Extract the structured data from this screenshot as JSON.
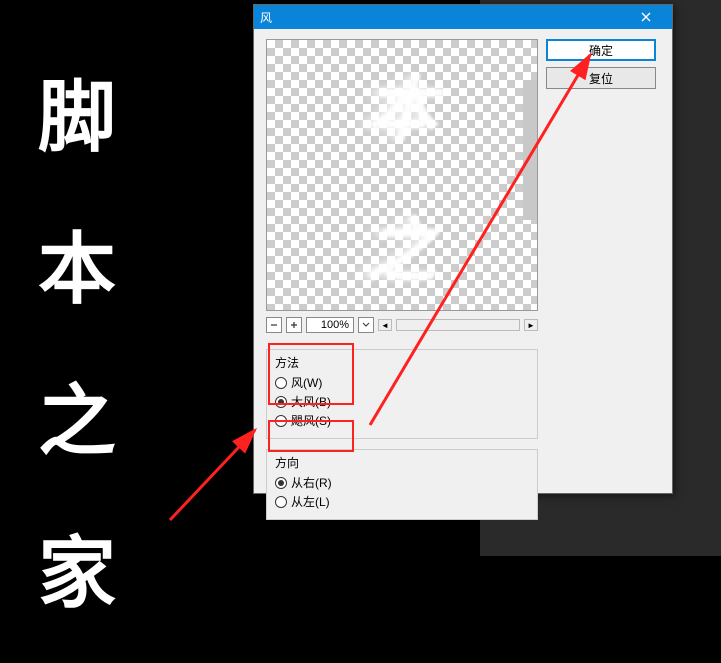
{
  "background_chars": [
    "脚",
    "本",
    "之",
    "家"
  ],
  "dialog": {
    "title": "风",
    "preview_chars": [
      "本",
      "之"
    ],
    "zoom": {
      "level": "100%"
    },
    "buttons": {
      "ok": "确定",
      "reset": "复位"
    },
    "method": {
      "legend": "方法",
      "options": [
        {
          "label": "风(W)",
          "checked": false
        },
        {
          "label": "大风(B)",
          "checked": true
        },
        {
          "label": "飓风(S)",
          "checked": false
        }
      ]
    },
    "direction": {
      "legend": "方向",
      "options": [
        {
          "label": "从右(R)",
          "checked": true
        },
        {
          "label": "从左(L)",
          "checked": false
        }
      ]
    }
  },
  "annotations": {
    "highlight_color": "#ff2020",
    "arrow_color": "#ff2020"
  }
}
